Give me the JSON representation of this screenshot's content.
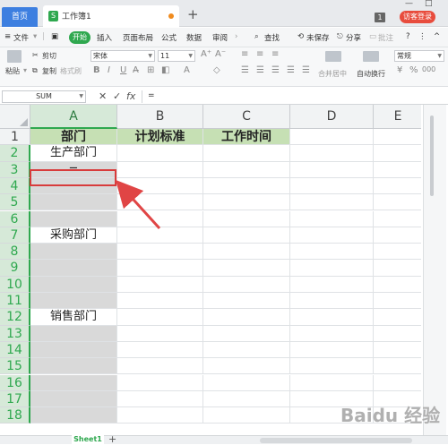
{
  "titlebar": {
    "home_tab": "首页",
    "doc_tab": "工作簿1",
    "add_tab": "+",
    "window_count": "1",
    "login": "访客登录",
    "minimize": "—",
    "maximize": "□"
  },
  "menubar": {
    "file": "文件",
    "start": "开始",
    "items": [
      "插入",
      "页面布局",
      "公式",
      "数据",
      "审阅"
    ],
    "search": "查找",
    "unsaved": "未保存",
    "share": "分享",
    "comment": "批注",
    "help": "?"
  },
  "ribbon": {
    "cut": "剪切",
    "paste": "粘贴",
    "copy": "复制",
    "format_painter": "格式刷",
    "font_name": "宋体",
    "font_size": "11",
    "merge_center": "合并居中",
    "wrap_text": "自动换行",
    "number_format": "常规"
  },
  "formula_bar": {
    "name_box": "SUM",
    "cancel": "✕",
    "confirm": "✓",
    "fx": "fx",
    "content": "="
  },
  "sheet": {
    "columns": [
      "A",
      "B",
      "C",
      "D",
      "E"
    ],
    "rows": [
      "1",
      "2",
      "3",
      "4",
      "5",
      "6",
      "7",
      "8",
      "9",
      "10",
      "11",
      "12",
      "13",
      "14",
      "15",
      "16",
      "17",
      "18"
    ],
    "headers": [
      "部门",
      "计划标准",
      "工作时间"
    ],
    "dept_production": "生产部门",
    "dept_purchase": "采购部门",
    "dept_sales": "销售部门",
    "editing_value": "=",
    "sheet_tab": "Sheet1",
    "add_sheet": "+"
  },
  "colors": {
    "accent": "#2fa84f",
    "header_fill": "#c6e0b4",
    "grey_fill": "#d9d9d9",
    "highlight_border": "#d83b3b",
    "arrow": "#e04545"
  },
  "watermark": "Baidu 经验"
}
